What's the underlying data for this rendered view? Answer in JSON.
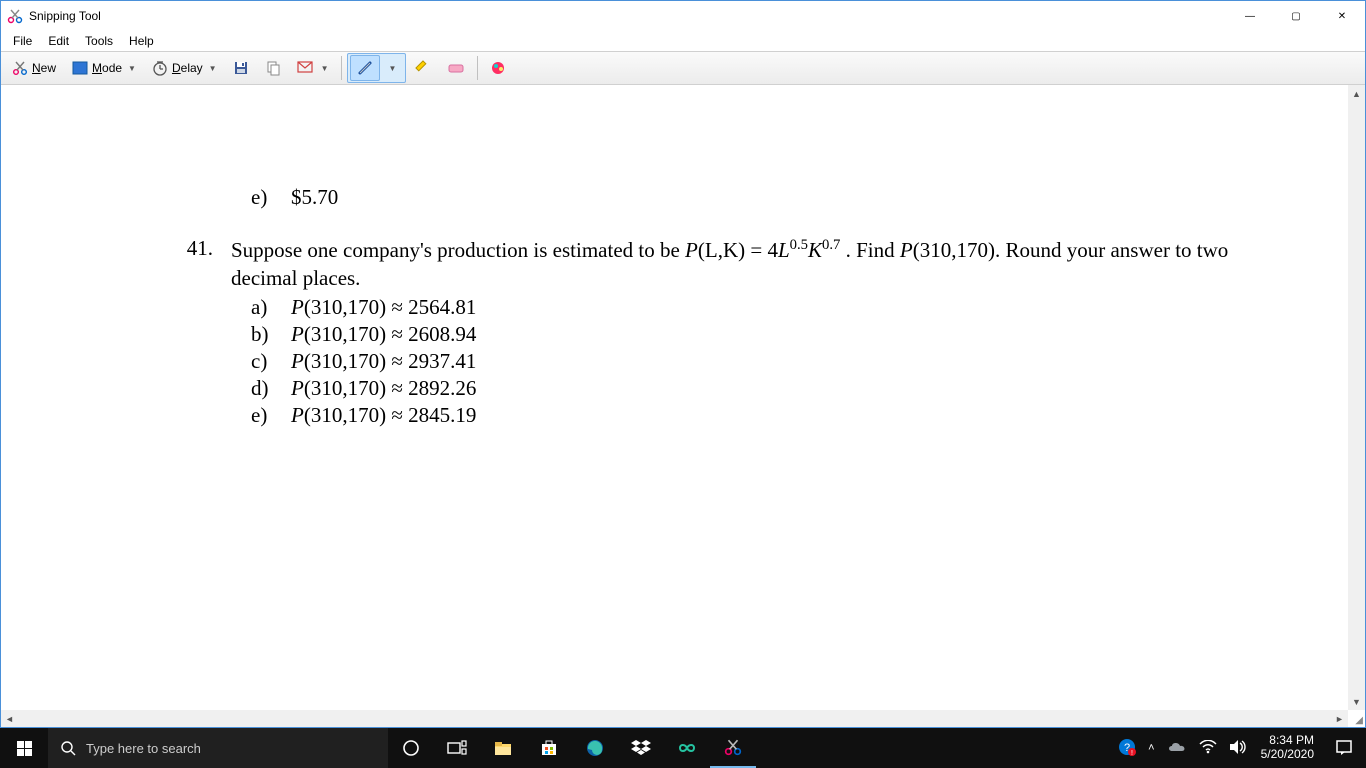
{
  "window": {
    "title": "Snipping Tool",
    "controls": {
      "min": "—",
      "max": "▢",
      "close": "✕"
    }
  },
  "menu": {
    "file": "File",
    "edit": "Edit",
    "tools": "Tools",
    "help": "Help"
  },
  "toolbar": {
    "new": "New",
    "mode": "Mode",
    "delay": "Delay"
  },
  "document": {
    "previous_option": {
      "letter": "e)",
      "text": "$5.70"
    },
    "question": {
      "number": "41.",
      "text_before_formula": "Suppose one company's production is estimated to be ",
      "formula_fn": "P",
      "formula_args": "(L,K)",
      "formula_eq": " = 4",
      "formula_L": "L",
      "formula_Lexp": "0.5",
      "formula_K": "K",
      "formula_Kexp": "0.7",
      "text_after_formula": ". Find ",
      "find_fn": "P",
      "find_args": "(310,170)",
      "text_tail": ". Round your answer to two decimal places."
    },
    "options": [
      {
        "letter": "a)",
        "value": "2564.81"
      },
      {
        "letter": "b)",
        "value": "2608.94"
      },
      {
        "letter": "c)",
        "value": "2937.41"
      },
      {
        "letter": "d)",
        "value": "2892.26"
      },
      {
        "letter": "e)",
        "value": "2845.19"
      }
    ],
    "opt_fn": "P",
    "opt_args": "(310,170)",
    "approx": " ≈ "
  },
  "taskbar": {
    "search_placeholder": "Type here to search",
    "time": "8:34 PM",
    "date": "5/20/2020"
  }
}
